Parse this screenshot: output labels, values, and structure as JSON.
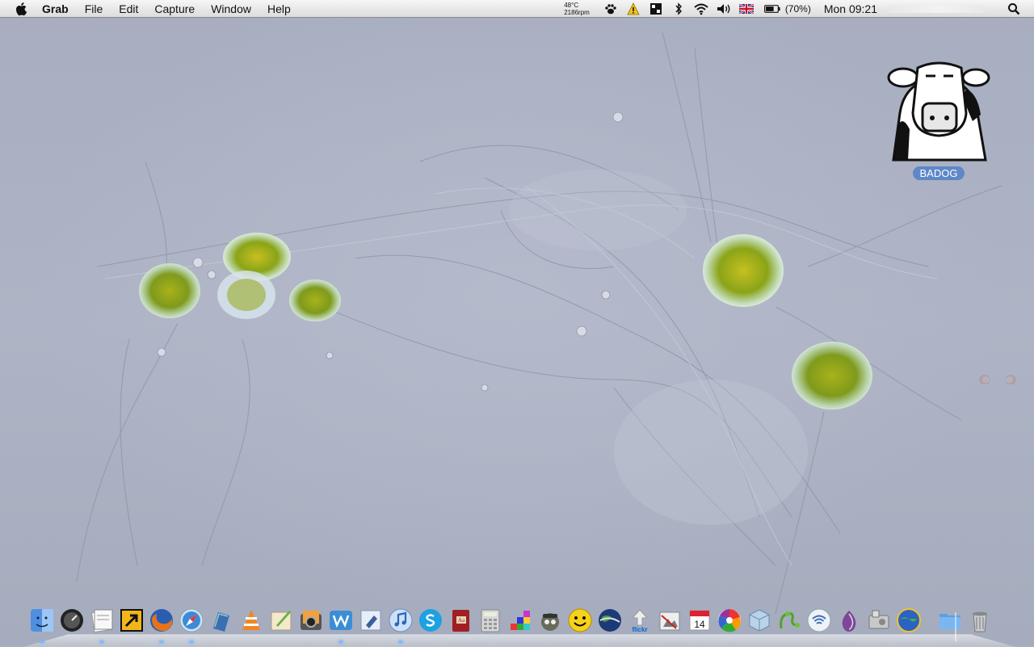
{
  "menubar": {
    "apple_icon": "apple-icon",
    "app_name": "Grab",
    "menus": [
      "File",
      "Edit",
      "Capture",
      "Window",
      "Help"
    ],
    "temperature": "48°C",
    "fan_speed": "2186rpm",
    "status_icons": [
      "paw-icon",
      "warning-icon",
      "grid-icon",
      "bluetooth-icon",
      "wifi-icon",
      "volume-icon",
      "uk-flag-icon"
    ],
    "battery_percent": "(70%)",
    "battery_level": 0.7,
    "clock": "Mon 09:21",
    "spotlight_icon": "spotlight-search-icon"
  },
  "desktop": {
    "wallpaper": "microscope image of green algae cells",
    "icon_label": "BADOG"
  },
  "dock": {
    "items": [
      {
        "name": "finder",
        "running": true
      },
      {
        "name": "dashboard",
        "running": false
      },
      {
        "name": "preview",
        "running": true
      },
      {
        "name": "alias",
        "running": false
      },
      {
        "name": "firefox",
        "running": true
      },
      {
        "name": "safari",
        "running": true
      },
      {
        "name": "papers",
        "running": false
      },
      {
        "name": "vlc",
        "running": false
      },
      {
        "name": "quill",
        "running": false
      },
      {
        "name": "iphoto",
        "running": false
      },
      {
        "name": "writer",
        "running": true
      },
      {
        "name": "preview-mail",
        "running": false
      },
      {
        "name": "itunes",
        "running": true
      },
      {
        "name": "skype",
        "running": false
      },
      {
        "name": "dictionary",
        "running": false
      },
      {
        "name": "calculator",
        "running": false
      },
      {
        "name": "tetris",
        "running": false
      },
      {
        "name": "spy-tool",
        "running": false
      },
      {
        "name": "adium-smiley",
        "running": false
      },
      {
        "name": "google-earth",
        "running": false
      },
      {
        "name": "flickr-uploader",
        "running": false
      },
      {
        "name": "image-tool",
        "running": false
      },
      {
        "name": "calendar",
        "running": false
      },
      {
        "name": "picasa",
        "running": false
      },
      {
        "name": "box-tool",
        "running": false
      },
      {
        "name": "vine",
        "running": false
      },
      {
        "name": "wifi-tool",
        "running": false
      },
      {
        "name": "tor-onion",
        "running": false
      },
      {
        "name": "disk-tool",
        "running": false
      },
      {
        "name": "globe-net",
        "running": false
      },
      {
        "name": "folder-blue",
        "running": false
      },
      {
        "name": "trash",
        "running": false
      }
    ],
    "calendar_day": "14",
    "flickr_label": "flickr"
  },
  "colors": {
    "wallpaper": "#a9b0c2",
    "algae_green": "#8fa51a",
    "menubar": "#e8e8e8",
    "label_bg": "#5e88c7"
  }
}
